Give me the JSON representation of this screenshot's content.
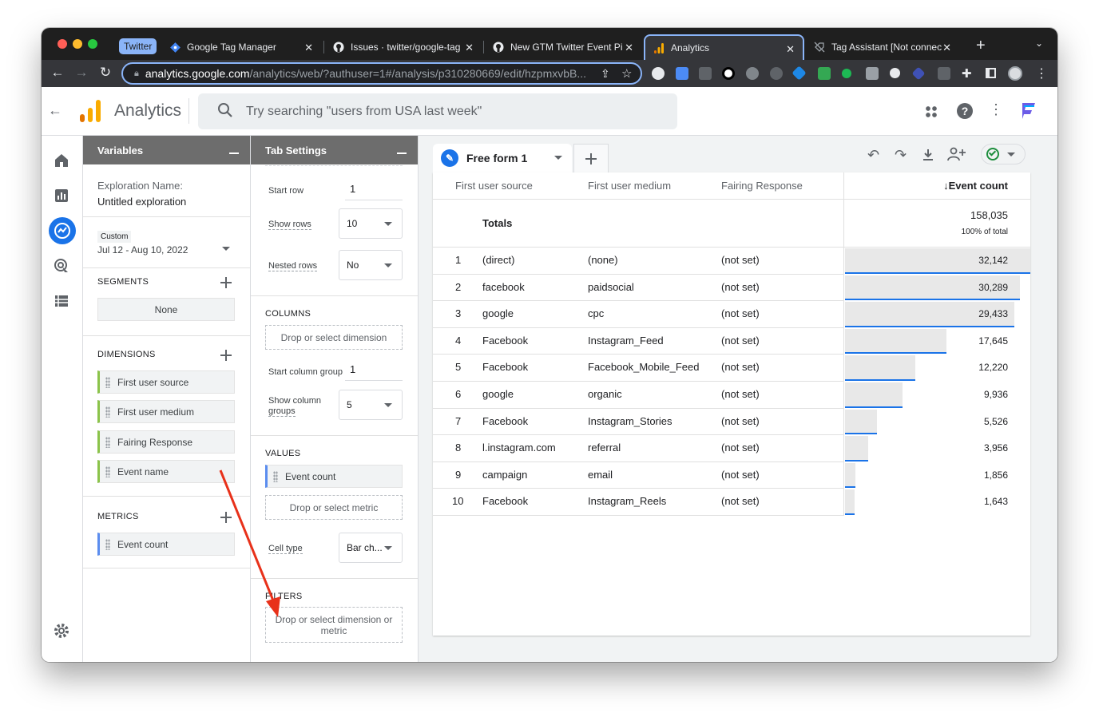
{
  "browser": {
    "tabs": [
      {
        "group": "Twitter",
        "label": "Google Tag Manager",
        "icon": "gtm-icon"
      },
      {
        "label": "Issues · twitter/google-tag",
        "icon": "github-icon"
      },
      {
        "label": "New GTM Twitter Event Pi",
        "icon": "github-icon"
      },
      {
        "label": "Analytics",
        "icon": "analytics-icon",
        "active": true
      },
      {
        "label": "Tag Assistant [Not connec",
        "icon": "tag-assistant-icon"
      }
    ],
    "new_tab": "+",
    "url_host": "analytics.google.com",
    "url_path": "/analytics/web/?authuser=1#/analysis/p310280669/edit/hzpmxvbB..."
  },
  "app": {
    "title": "Analytics",
    "search_placeholder": "Try searching \"users from USA last week\"",
    "accent": "#1a73e8"
  },
  "variables": {
    "title": "Variables",
    "exploration_label": "Exploration Name:",
    "exploration_name": "Untitled exploration",
    "date_tag": "Custom",
    "date_range": "Jul 12 - Aug 10, 2022",
    "segments_title": "SEGMENTS",
    "segments_none": "None",
    "dimensions_title": "DIMENSIONS",
    "dimensions": [
      "First user source",
      "First user medium",
      "Fairing Response",
      "Event name"
    ],
    "metrics_title": "METRICS",
    "metrics": [
      "Event count"
    ]
  },
  "tab_settings": {
    "title": "Tab Settings",
    "start_row_label": "Start row",
    "start_row": "1",
    "show_rows_label": "Show rows",
    "show_rows": "10",
    "nested_rows_label": "Nested rows",
    "nested_rows": "No",
    "columns_title": "COLUMNS",
    "columns_drop": "Drop or select dimension",
    "start_col_label": "Start column group",
    "start_col": "1",
    "show_col_label_1": "Show column",
    "show_col_label_2": "groups",
    "show_col": "5",
    "values_title": "VALUES",
    "value_chip": "Event count",
    "values_drop": "Drop or select metric",
    "cell_type_label": "Cell type",
    "cell_type": "Bar ch...",
    "filters_title": "FILTERS",
    "filters_drop_1": "Drop or select dimension or",
    "filters_drop_2": "metric"
  },
  "report": {
    "tab_name": "Free form 1",
    "headers": [
      "First user source",
      "First user medium",
      "Fairing Response",
      "↓Event count"
    ],
    "totals_label": "Totals",
    "totals_value": "158,035",
    "totals_pct": "100% of total",
    "rows": [
      {
        "n": "1",
        "source": "(direct)",
        "medium": "(none)",
        "fairing": "(not set)",
        "count": "32,142",
        "value": 32142
      },
      {
        "n": "2",
        "source": "facebook",
        "medium": "paidsocial",
        "fairing": "(not set)",
        "count": "30,289",
        "value": 30289
      },
      {
        "n": "3",
        "source": "google",
        "medium": "cpc",
        "fairing": "(not set)",
        "count": "29,433",
        "value": 29433
      },
      {
        "n": "4",
        "source": "Facebook",
        "medium": "Instagram_Feed",
        "fairing": "(not set)",
        "count": "17,645",
        "value": 17645
      },
      {
        "n": "5",
        "source": "Facebook",
        "medium": "Facebook_Mobile_Feed",
        "fairing": "(not set)",
        "count": "12,220",
        "value": 12220
      },
      {
        "n": "6",
        "source": "google",
        "medium": "organic",
        "fairing": "(not set)",
        "count": "9,936",
        "value": 9936
      },
      {
        "n": "7",
        "source": "Facebook",
        "medium": "Instagram_Stories",
        "fairing": "(not set)",
        "count": "5,526",
        "value": 5526
      },
      {
        "n": "8",
        "source": "l.instagram.com",
        "medium": "referral",
        "fairing": "(not set)",
        "count": "3,956",
        "value": 3956
      },
      {
        "n": "9",
        "source": "campaign",
        "medium": "email",
        "fairing": "(not set)",
        "count": "1,856",
        "value": 1856
      },
      {
        "n": "10",
        "source": "Facebook",
        "medium": "Instagram_Reels",
        "fairing": "(not set)",
        "count": "1,643",
        "value": 1643
      }
    ]
  }
}
